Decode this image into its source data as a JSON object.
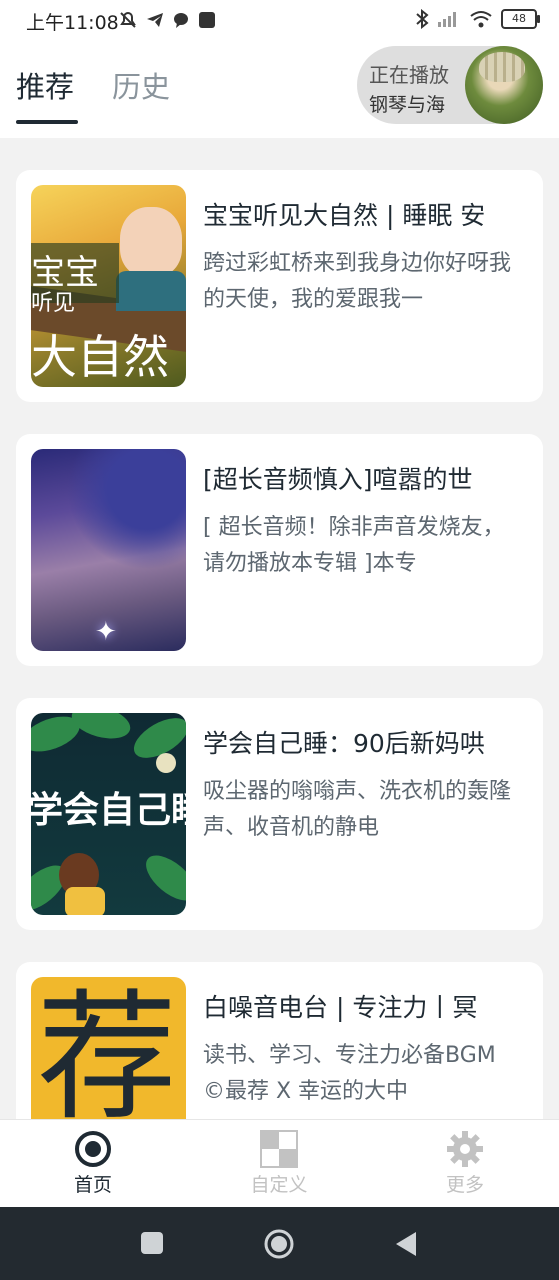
{
  "status_bar": {
    "time": "上午11:08",
    "battery": "48",
    "icons": [
      "mute-icon",
      "telegram-icon",
      "chat-bubble-icon",
      "square-app-icon",
      "bluetooth-icon",
      "signal-icon",
      "wifi-icon",
      "battery-icon"
    ]
  },
  "header": {
    "tabs": [
      {
        "label": "推荐",
        "active": true
      },
      {
        "label": "历史",
        "active": false
      }
    ],
    "now_playing": {
      "label": "正在播放",
      "title": "钢琴与海"
    }
  },
  "albums": [
    {
      "title": "宝宝听见大自然 | 睡眠 安",
      "description": "跨过彩虹桥来到我身边你好呀我的天使，我的爱跟我一",
      "cover_text": [
        "宝宝",
        "听见",
        "大自然"
      ]
    },
    {
      "title": "[超长音频慎入]喧嚣的世",
      "description": "[ 超长音频！除非声音发烧友，请勿播放本专辑 ]本专"
    },
    {
      "title": "学会自己睡：90后新妈哄",
      "description": "吸尘器的嗡嗡声、洗衣机的轰隆声、收音机的静电",
      "cover_text": [
        "学会自己睡"
      ]
    },
    {
      "title": "白噪音电台 | 专注力丨冥",
      "description": "读书、学习、专注力必备BGM ©最荐 X 幸运的大中",
      "cover_text": [
        "荐"
      ]
    }
  ],
  "bottom_nav": [
    {
      "label": "首页",
      "icon": "target-icon",
      "active": true,
      "color": "#1f2a33"
    },
    {
      "label": "自定义",
      "icon": "checker-icon",
      "active": false,
      "color": "#c2c2c2"
    },
    {
      "label": "更多",
      "icon": "gear-icon",
      "active": false,
      "color": "#c2c2c2"
    }
  ],
  "system_nav": [
    "recents-square-icon",
    "home-circle-icon",
    "back-triangle-icon"
  ]
}
